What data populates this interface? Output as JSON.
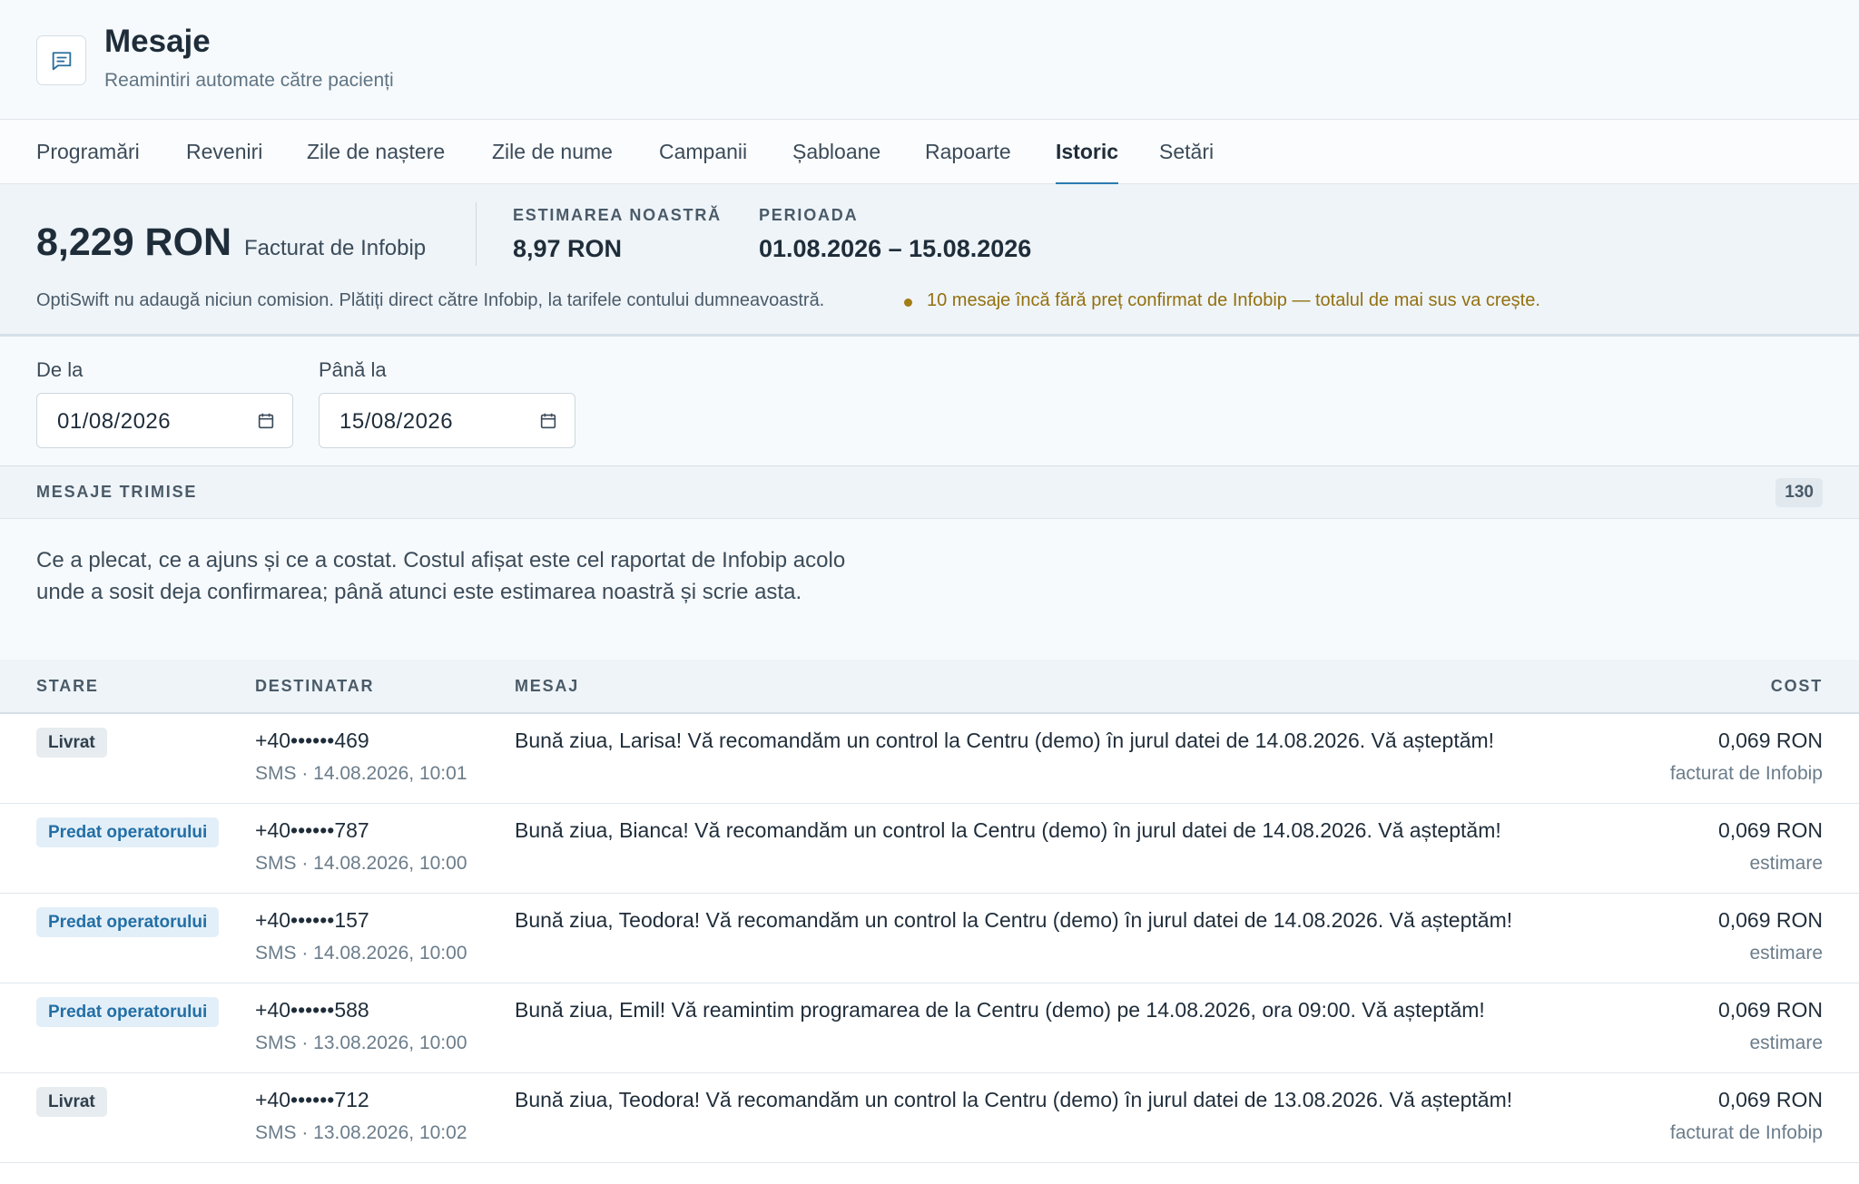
{
  "header": {
    "title": "Mesaje",
    "subtitle": "Reamintiri automate către pacienți",
    "icon": "message-icon"
  },
  "tabs": [
    {
      "label": "Programări",
      "active": false
    },
    {
      "label": "Reveniri",
      "active": false
    },
    {
      "label": "Zile de naștere",
      "active": false
    },
    {
      "label": "Zile de nume",
      "active": false
    },
    {
      "label": "Campanii",
      "active": false
    },
    {
      "label": "Șabloane",
      "active": false
    },
    {
      "label": "Rapoarte",
      "active": false
    },
    {
      "label": "Istoric",
      "active": true
    },
    {
      "label": "Setări",
      "active": false
    }
  ],
  "summary": {
    "billed_amount": "8,229 RON",
    "billed_label": "Facturat de Infobip",
    "estimate_label": "ESTIMAREA NOASTRĂ",
    "estimate_value": "8,97 RON",
    "period_label": "PERIOADA",
    "period_value": "01.08.2026 – 15.08.2026",
    "note": "OptiSwift nu adaugă niciun comision. Plătiți direct către Infobip, la tarifele contului dumneavoastră.",
    "warning": "10 mesaje încă fără preț confirmat de Infobip — totalul de mai sus va crește.",
    "warning_color": "#94700f"
  },
  "filters": {
    "from_label": "De la",
    "from_value": "01/08/2026",
    "to_label": "Până la",
    "to_value": "15/08/2026"
  },
  "section": {
    "title": "MESAJE TRIMISE",
    "count": "130",
    "description": "Ce a plecat, ce a ajuns și ce a costat. Costul afișat este cel raportat de Infobip acolo unde a sosit deja confirmarea; până atunci este estimarea noastră și scrie asta."
  },
  "table": {
    "columns": {
      "status": "STARE",
      "recipient": "DESTINATAR",
      "message": "MESAJ",
      "cost": "COST"
    },
    "rows": [
      {
        "status": "Livrat",
        "status_kind": "delivered",
        "phone": "+40••••••469",
        "meta": "SMS · 14.08.2026, 10:01",
        "message": "Bună ziua, Larisa! Vă recomandăm un control la Centru (demo) în jurul datei de 14.08.2026. Vă așteptăm!",
        "cost": "0,069 RON",
        "cost_source": "facturat de Infobip"
      },
      {
        "status": "Predat operatorului",
        "status_kind": "operator",
        "phone": "+40••••••787",
        "meta": "SMS · 14.08.2026, 10:00",
        "message": "Bună ziua, Bianca! Vă recomandăm un control la Centru (demo) în jurul datei de 14.08.2026. Vă așteptăm!",
        "cost": "0,069 RON",
        "cost_source": "estimare"
      },
      {
        "status": "Predat operatorului",
        "status_kind": "operator",
        "phone": "+40••••••157",
        "meta": "SMS · 14.08.2026, 10:00",
        "message": "Bună ziua, Teodora! Vă recomandăm un control la Centru (demo) în jurul datei de 14.08.2026. Vă așteptăm!",
        "cost": "0,069 RON",
        "cost_source": "estimare"
      },
      {
        "status": "Predat operatorului",
        "status_kind": "operator",
        "phone": "+40••••••588",
        "meta": "SMS · 13.08.2026, 10:00",
        "message": "Bună ziua, Emil! Vă reamintim programarea de la Centru (demo) pe 14.08.2026, ora 09:00. Vă așteptăm!",
        "cost": "0,069 RON",
        "cost_source": "estimare"
      },
      {
        "status": "Livrat",
        "status_kind": "delivered",
        "phone": "+40••••••712",
        "meta": "SMS · 13.08.2026, 10:02",
        "message": "Bună ziua, Teodora! Vă recomandăm un control la Centru (demo) în jurul datei de 13.08.2026. Vă așteptăm!",
        "cost": "0,069 RON",
        "cost_source": "facturat de Infobip"
      }
    ]
  }
}
